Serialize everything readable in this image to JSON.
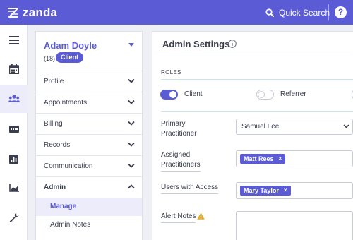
{
  "app": {
    "name": "zanda",
    "brand_color": "#5b5bd6",
    "quick_search_label": "Quick Search",
    "help_label": "?"
  },
  "rail": {
    "items": [
      {
        "icon": "hamburger-menu-icon"
      },
      {
        "icon": "calendar-icon"
      },
      {
        "icon": "clients-group-icon",
        "active": true
      },
      {
        "icon": "billing-card-icon"
      },
      {
        "icon": "reports-chart-icon"
      },
      {
        "icon": "analytics-line-chart-icon"
      },
      {
        "icon": "wrench-settings-icon"
      }
    ]
  },
  "client": {
    "name": "Adam Doyle",
    "age": "(18)",
    "badge": "Client",
    "nav": [
      {
        "label": "Profile",
        "expanded": false
      },
      {
        "label": "Appointments",
        "expanded": false
      },
      {
        "label": "Billing",
        "expanded": false
      },
      {
        "label": "Records",
        "expanded": false
      },
      {
        "label": "Communication",
        "expanded": false
      },
      {
        "label": "Admin",
        "expanded": true
      }
    ],
    "admin_sub": [
      {
        "label": "Manage",
        "active": true
      },
      {
        "label": "Admin Notes",
        "active": false
      }
    ]
  },
  "admin_settings": {
    "title": "Admin Settings",
    "roles_label": "ROLES",
    "roles": [
      {
        "label": "Client",
        "on": true
      },
      {
        "label": "Referrer",
        "on": false
      }
    ],
    "primary_practitioner": {
      "label_line1": "Primary",
      "label_line2": "Practitioner",
      "value": "Samuel Lee"
    },
    "assigned_practitioners": {
      "label_line1": "Assigned",
      "label_line2": "Practitioners",
      "chips": [
        "Matt Rees"
      ]
    },
    "users_with_access": {
      "label": "Users with Access",
      "chips": [
        "Mary Taylor"
      ]
    },
    "alert_notes": {
      "label": "Alert Notes",
      "value": ""
    },
    "chip_remove_glyph": "×"
  }
}
